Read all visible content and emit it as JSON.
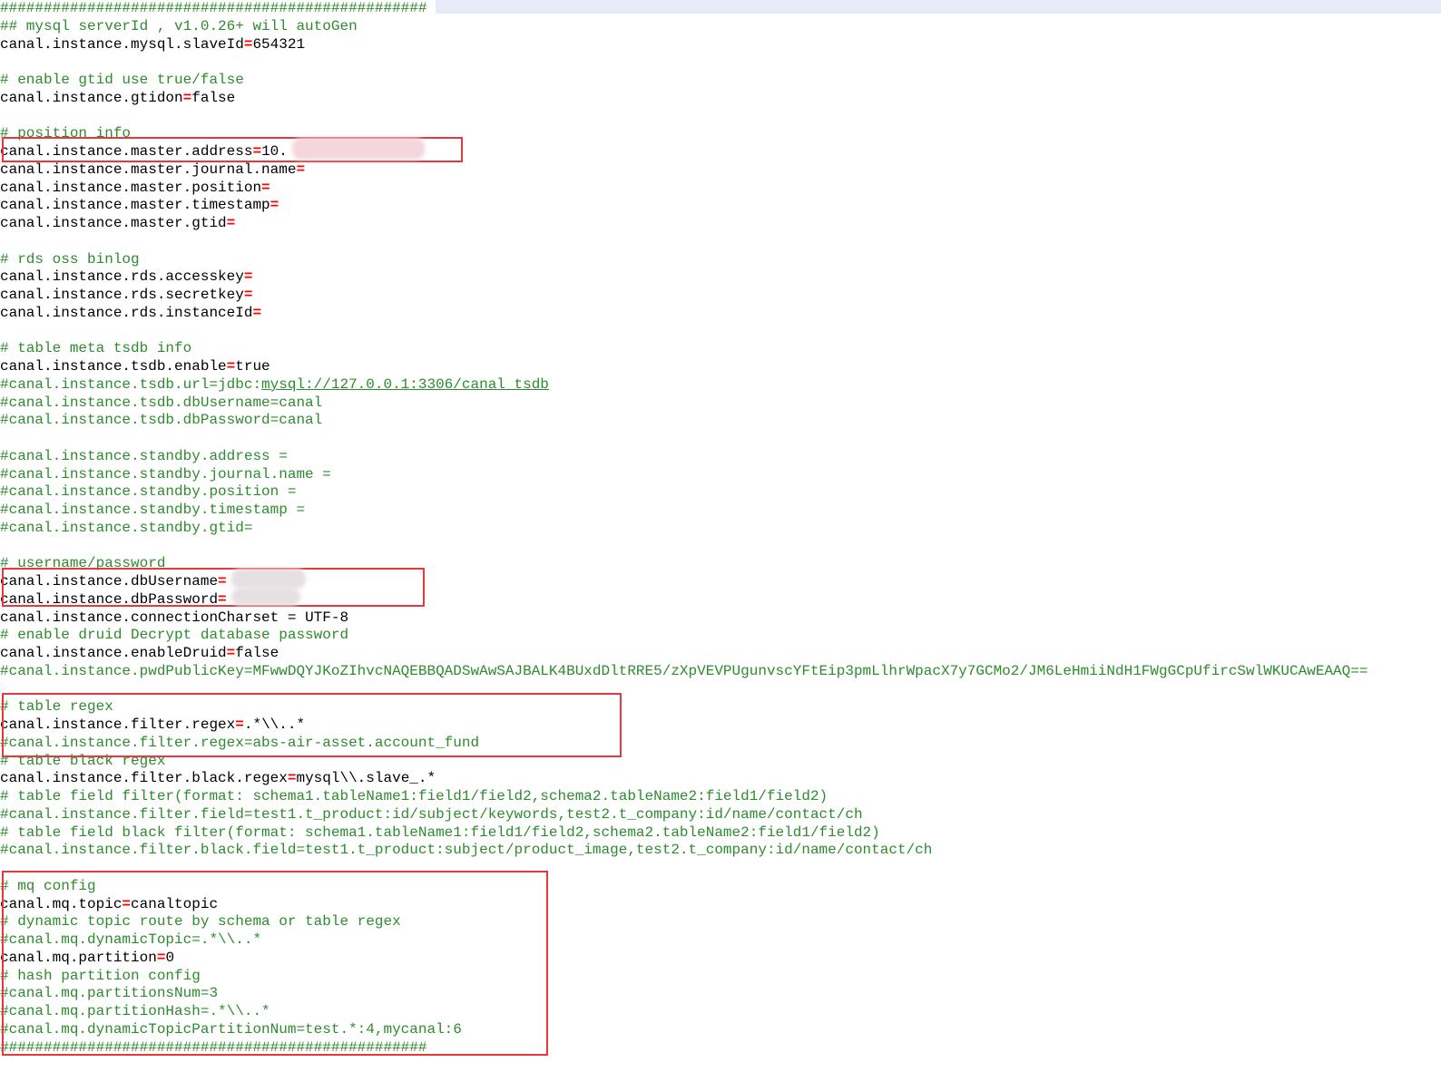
{
  "editor": {
    "lines": [
      {
        "type": "comment",
        "text": "#################################################"
      },
      {
        "type": "comment",
        "text": "## mysql serverId , v1.0.26+ will autoGen"
      },
      {
        "type": "kv",
        "key": "canal.instance.mysql.slaveId",
        "value": "654321"
      },
      {
        "type": "blank"
      },
      {
        "type": "comment",
        "text": "# enable gtid use true/false"
      },
      {
        "type": "kv",
        "key": "canal.instance.gtidon",
        "value": "false"
      },
      {
        "type": "blank"
      },
      {
        "type": "comment",
        "text": "# position info"
      },
      {
        "type": "kv",
        "key": "canal.instance.master.address",
        "value": "10."
      },
      {
        "type": "kv",
        "key": "canal.instance.master.journal.name",
        "value": ""
      },
      {
        "type": "kv",
        "key": "canal.instance.master.position",
        "value": ""
      },
      {
        "type": "kv",
        "key": "canal.instance.master.timestamp",
        "value": ""
      },
      {
        "type": "kv",
        "key": "canal.instance.master.gtid",
        "value": ""
      },
      {
        "type": "blank"
      },
      {
        "type": "comment",
        "text": "# rds oss binlog"
      },
      {
        "type": "kv",
        "key": "canal.instance.rds.accesskey",
        "value": ""
      },
      {
        "type": "kv",
        "key": "canal.instance.rds.secretkey",
        "value": ""
      },
      {
        "type": "kv",
        "key": "canal.instance.rds.instanceId",
        "value": ""
      },
      {
        "type": "blank"
      },
      {
        "type": "comment",
        "text": "# table meta tsdb info"
      },
      {
        "type": "kv",
        "key": "canal.instance.tsdb.enable",
        "value": "true"
      },
      {
        "type": "comment-link",
        "pre": "#canal.instance.tsdb.url=jdbc:",
        "link": "mysql://127.0.0.1:3306/canal_tsdb"
      },
      {
        "type": "comment",
        "text": "#canal.instance.tsdb.dbUsername=canal"
      },
      {
        "type": "comment",
        "text": "#canal.instance.tsdb.dbPassword=canal"
      },
      {
        "type": "blank"
      },
      {
        "type": "comment",
        "text": "#canal.instance.standby.address ="
      },
      {
        "type": "comment",
        "text": "#canal.instance.standby.journal.name ="
      },
      {
        "type": "comment",
        "text": "#canal.instance.standby.position ="
      },
      {
        "type": "comment",
        "text": "#canal.instance.standby.timestamp ="
      },
      {
        "type": "comment",
        "text": "#canal.instance.standby.gtid="
      },
      {
        "type": "blank"
      },
      {
        "type": "comment",
        "text": "# username/password"
      },
      {
        "type": "kv",
        "key": "canal.instance.dbUsername",
        "value": ""
      },
      {
        "type": "kv",
        "key": "canal.instance.dbPassword",
        "value": ""
      },
      {
        "type": "kv-plain",
        "key": "canal.instance.connectionCharset ",
        "value": " UTF-8"
      },
      {
        "type": "comment",
        "text": "# enable druid Decrypt database password"
      },
      {
        "type": "kv",
        "key": "canal.instance.enableDruid",
        "value": "false"
      },
      {
        "type": "comment",
        "text": "#canal.instance.pwdPublicKey=MFwwDQYJKoZIhvcNAQEBBQADSwAwSAJBALK4BUxdDltRRE5/zXpVEVPUgunvscYFtEip3pmLlhrWpacX7y7GCMo2/JM6LeHmiiNdH1FWgGCpUfircSwlWKUCAwEAAQ=="
      },
      {
        "type": "blank"
      },
      {
        "type": "comment",
        "text": "# table regex"
      },
      {
        "type": "kv",
        "key": "canal.instance.filter.regex",
        "value": ".*\\\\..*"
      },
      {
        "type": "comment",
        "text": "#canal.instance.filter.regex=abs-air-asset.account_fund"
      },
      {
        "type": "comment",
        "text": "# table black regex"
      },
      {
        "type": "kv",
        "key": "canal.instance.filter.black.regex",
        "value": "mysql\\\\.slave_.*"
      },
      {
        "type": "comment",
        "text": "# table field filter(format: schema1.tableName1:field1/field2,schema2.tableName2:field1/field2)"
      },
      {
        "type": "comment",
        "text": "#canal.instance.filter.field=test1.t_product:id/subject/keywords,test2.t_company:id/name/contact/ch"
      },
      {
        "type": "comment",
        "text": "# table field black filter(format: schema1.tableName1:field1/field2,schema2.tableName2:field1/field2)"
      },
      {
        "type": "comment",
        "text": "#canal.instance.filter.black.field=test1.t_product:subject/product_image,test2.t_company:id/name/contact/ch"
      },
      {
        "type": "blank"
      },
      {
        "type": "comment",
        "text": "# mq config"
      },
      {
        "type": "kv",
        "key": "canal.mq.topic",
        "value": "canaltopic"
      },
      {
        "type": "comment",
        "text": "# dynamic topic route by schema or table regex"
      },
      {
        "type": "comment",
        "text": "#canal.mq.dynamicTopic=.*\\\\..*"
      },
      {
        "type": "kv",
        "key": "canal.mq.partition",
        "value": "0"
      },
      {
        "type": "comment",
        "text": "# hash partition config"
      },
      {
        "type": "comment",
        "text": "#canal.mq.partitionsNum=3"
      },
      {
        "type": "comment",
        "text": "#canal.mq.partitionHash=.*\\\\..*"
      },
      {
        "type": "comment",
        "text": "#canal.mq.dynamicTopicPartitionNum=test.*:4,mycanal:6"
      },
      {
        "type": "comment",
        "text": "#################################################"
      }
    ],
    "colors": {
      "comment": "#2e8b2e",
      "key": "#000000",
      "equals": "#ff0000",
      "highlight_box": "#e8383d"
    }
  }
}
